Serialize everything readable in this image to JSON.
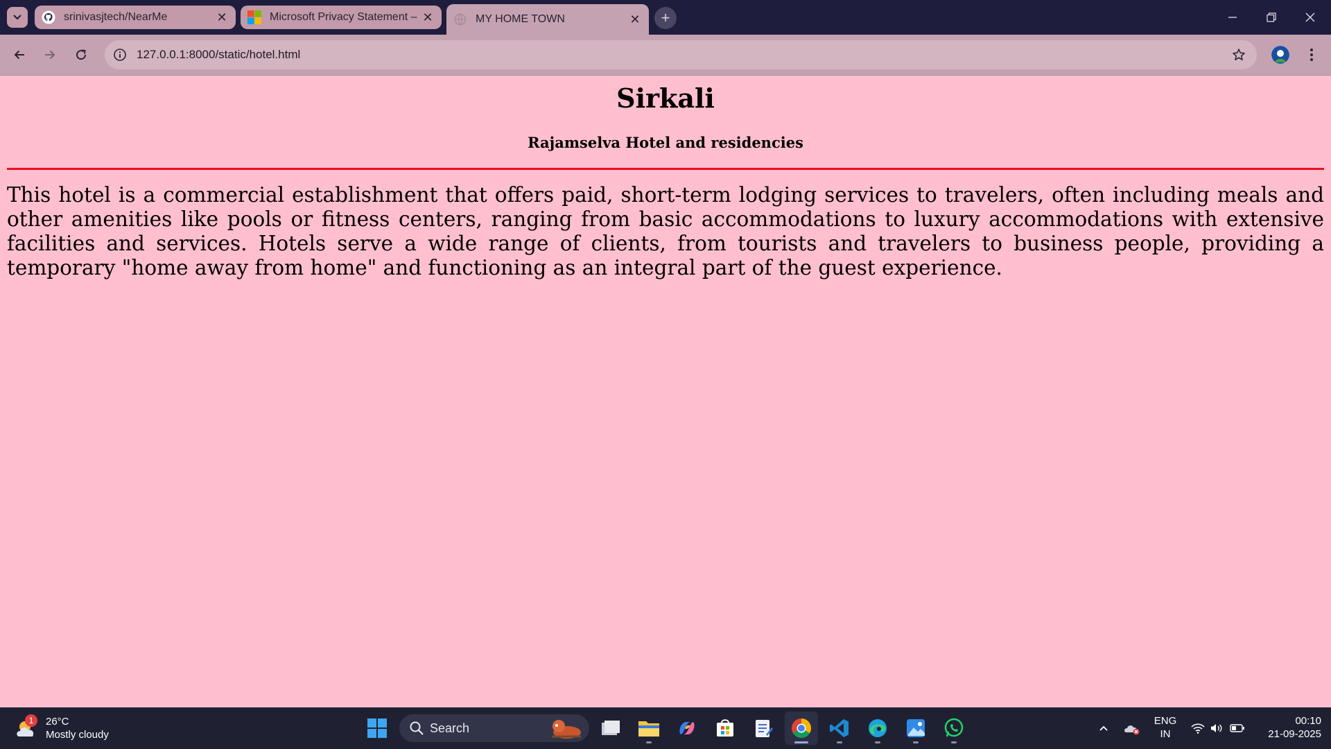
{
  "browser": {
    "tabs": [
      {
        "title": "srinivasjtech/NearMe",
        "favicon": "github-icon"
      },
      {
        "title": "Microsoft Privacy Statement – M",
        "favicon": "microsoft-icon"
      },
      {
        "title": "MY HOME TOWN",
        "favicon": "globe-icon",
        "active": true
      }
    ],
    "url": "127.0.0.1:8000/static/hotel.html"
  },
  "page": {
    "heading": "Sirkali",
    "subheading": "Rajamselva Hotel and residencies",
    "paragraph": "This hotel is a commercial establishment that offers paid, short-term lodging services to travelers, often including meals and other amenities like pools or fitness centers, ranging from basic accommodations to luxury accommodations with extensive facilities and services. Hotels serve a wide range of clients, from tourists and travelers to business people, providing a temporary \"home away from home\" and functioning as an integral part of the guest experience.",
    "background_color": "#ffbfcf",
    "rule_color": "#e8101f"
  },
  "taskbar": {
    "weather": {
      "temp": "26°C",
      "condition": "Mostly cloudy",
      "badge": "1"
    },
    "search_label": "Search",
    "apps": [
      "task-view-icon",
      "file-explorer-icon",
      "copilot-icon",
      "microsoft-store-icon",
      "notepad-icon",
      "chrome-icon",
      "vscode-icon",
      "edge-icon",
      "photos-icon",
      "whatsapp-icon"
    ],
    "active_app": "chrome-icon",
    "lang_line1": "ENG",
    "lang_line2": "IN",
    "time": "00:10",
    "date": "21-09-2025"
  }
}
